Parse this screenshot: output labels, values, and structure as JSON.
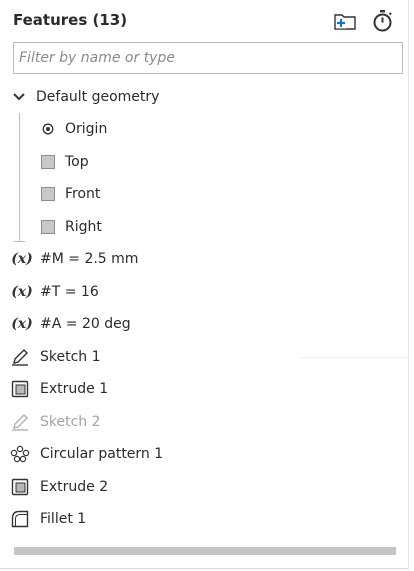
{
  "panel": {
    "title": "Features (13)",
    "add_folder_icon": "folder-add-icon",
    "rollback_icon": "stopwatch-icon"
  },
  "filter": {
    "placeholder": "Filter by name or type",
    "value": ""
  },
  "default_geometry": {
    "label": "Default geometry",
    "expanded": true,
    "items": [
      {
        "label": "Origin",
        "icon": "origin-icon"
      },
      {
        "label": "Top",
        "icon": "plane-icon"
      },
      {
        "label": "Front",
        "icon": "plane-icon"
      },
      {
        "label": "Right",
        "icon": "plane-icon"
      }
    ]
  },
  "variables": [
    {
      "label": "#M = 2.5 mm",
      "icon": "variable-icon",
      "icon_text": "(x)"
    },
    {
      "label": "#T = 16",
      "icon": "variable-icon",
      "icon_text": "(x)"
    },
    {
      "label": "#A = 20 deg",
      "icon": "variable-icon",
      "icon_text": "(x)"
    }
  ],
  "features": [
    {
      "label": "Sketch 1",
      "icon": "sketch-icon",
      "suppressed": false
    },
    {
      "label": "Extrude 1",
      "icon": "extrude-icon",
      "suppressed": false
    },
    {
      "label": "Sketch 2",
      "icon": "sketch-icon",
      "suppressed": true
    },
    {
      "label": "Circular pattern 1",
      "icon": "circular-pattern-icon",
      "suppressed": false
    },
    {
      "label": "Extrude 2",
      "icon": "extrude-icon",
      "suppressed": false
    },
    {
      "label": "Fillet 1",
      "icon": "fillet-icon",
      "suppressed": false
    }
  ],
  "colors": {
    "accent": "#1e73be",
    "text": "#2b2b2b",
    "disabled_text": "#a3a3a3"
  }
}
